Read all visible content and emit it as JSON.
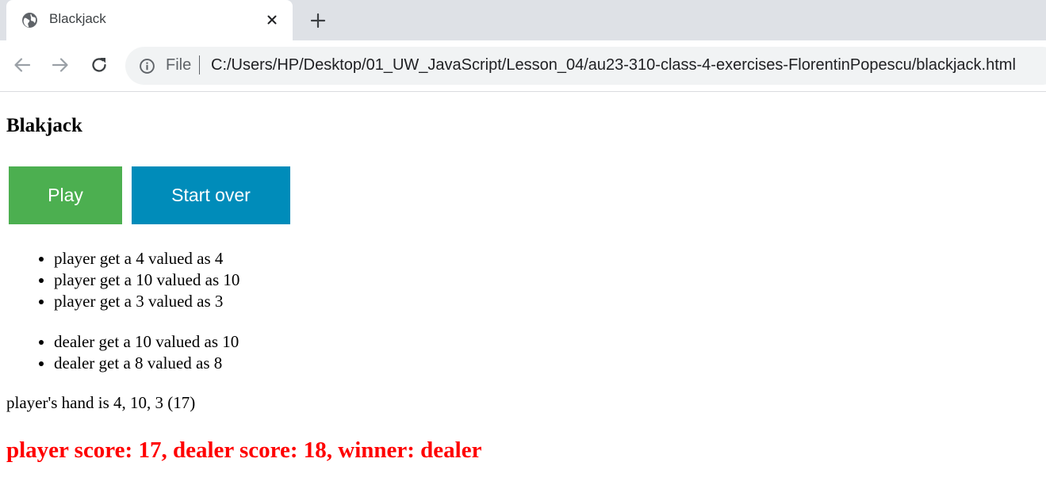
{
  "browser": {
    "tab": {
      "title": "Blackjack",
      "favicon": "globe-icon"
    },
    "url": {
      "scheme_label": "File",
      "path": "C:/Users/HP/Desktop/01_UW_JavaScript/Lesson_04/au23-310-class-4-exercises-FlorentinPopescu/blackjack.html"
    },
    "icons": {
      "close": "close-icon",
      "new_tab": "plus-icon",
      "back": "arrow-left-icon",
      "forward": "arrow-right-icon",
      "reload": "reload-icon",
      "info": "info-icon"
    }
  },
  "page": {
    "title": "Blakjack",
    "buttons": {
      "play": "Play",
      "start_over": "Start over"
    },
    "player_cards": [
      "player get a 4 valued as 4",
      "player get a 10 valued as 10",
      "player get a 3 valued as 3"
    ],
    "dealer_cards": [
      "dealer get a 10 valued as 10",
      "dealer get a 8 valued as 8"
    ],
    "hand_text": "player's hand is 4, 10, 3 (17)",
    "result_text": "player score: 17, dealer score: 18, winner: dealer"
  },
  "colors": {
    "play_button": "#4caf50",
    "start_over_button": "#008cba",
    "result_text": "#ff0000",
    "tab_strip": "#dee1e6",
    "omnibox": "#f1f3f4"
  }
}
